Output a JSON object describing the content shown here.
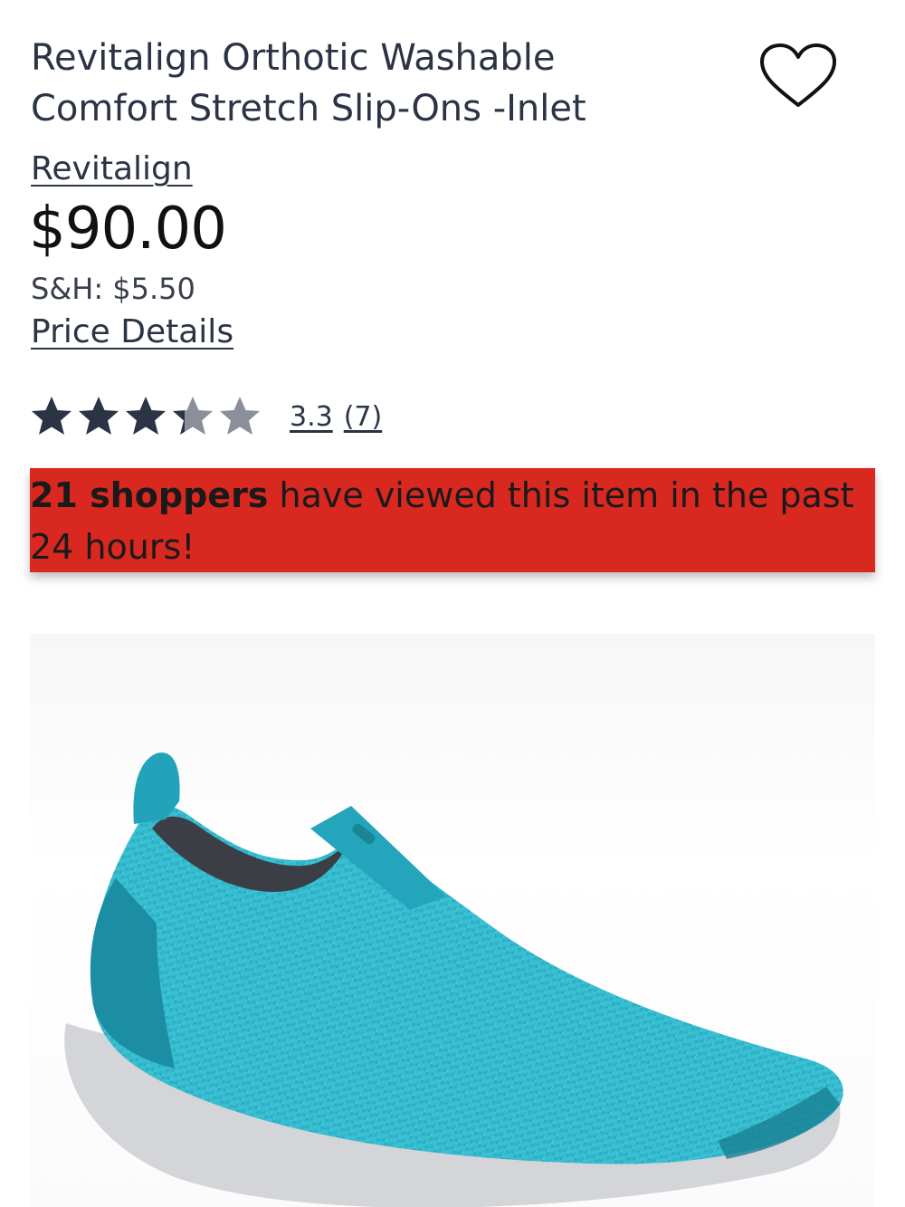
{
  "product": {
    "title_line1": "Revitalign Orthotic Washable",
    "title_line2": "Comfort Stretch Slip-Ons -Inlet",
    "brand": "Revitalign",
    "price": "$90.00",
    "shipping": "S&H: $5.50",
    "price_details_label": "Price Details"
  },
  "rating": {
    "value": 3.3,
    "display": "3.3",
    "count_display": "(7)",
    "max": 5
  },
  "banner": {
    "bold_text": "21 shoppers",
    "rest_text": " have viewed this item in the past 24 hours!"
  },
  "image": {
    "icon": "shoe-product-image",
    "subject_color": "#2aa9bf"
  },
  "colors": {
    "text": "#2b3345",
    "banner": "#d9281f",
    "star_filled": "#2b3345",
    "star_empty": "#8a8f99"
  },
  "icons": {
    "wishlist": "heart-icon",
    "star": "star-icon"
  }
}
